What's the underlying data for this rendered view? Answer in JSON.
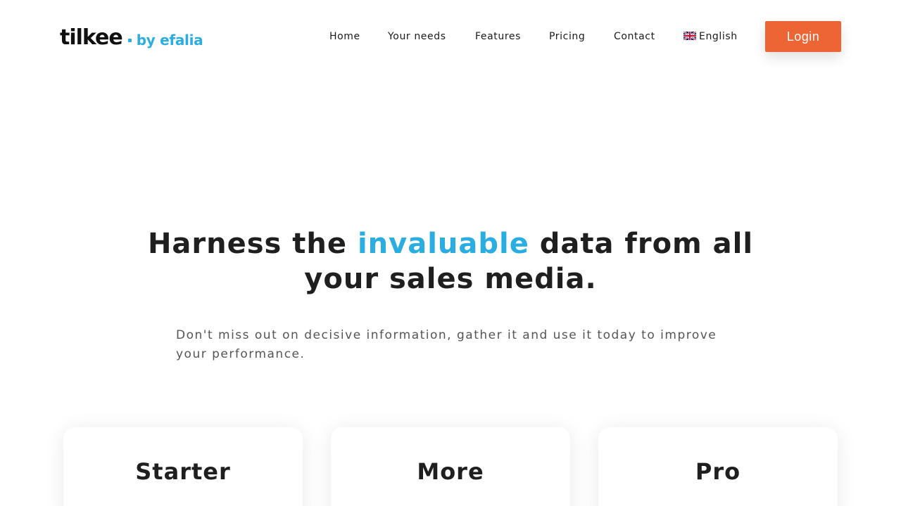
{
  "brand": {
    "logo_main": "tilkee",
    "logo_by": "by efalia",
    "accent_color": "#2aaee2",
    "cta_color": "#ee6535"
  },
  "nav": {
    "items": [
      {
        "label": "Home"
      },
      {
        "label": "Your needs"
      },
      {
        "label": "Features"
      },
      {
        "label": "Pricing"
      },
      {
        "label": "Contact"
      }
    ],
    "language": {
      "label": "English",
      "icon": "uk-flag-icon"
    },
    "login_label": "Login"
  },
  "hero": {
    "title_part1": "Harness the ",
    "title_accent": "invaluable",
    "title_part2": " data from all",
    "title_line2": "your sales media.",
    "subtitle": "Don't miss out on decisive information, gather it and use it today to improve your performance."
  },
  "plans": [
    {
      "name": "Starter"
    },
    {
      "name": "More"
    },
    {
      "name": "Pro"
    }
  ]
}
